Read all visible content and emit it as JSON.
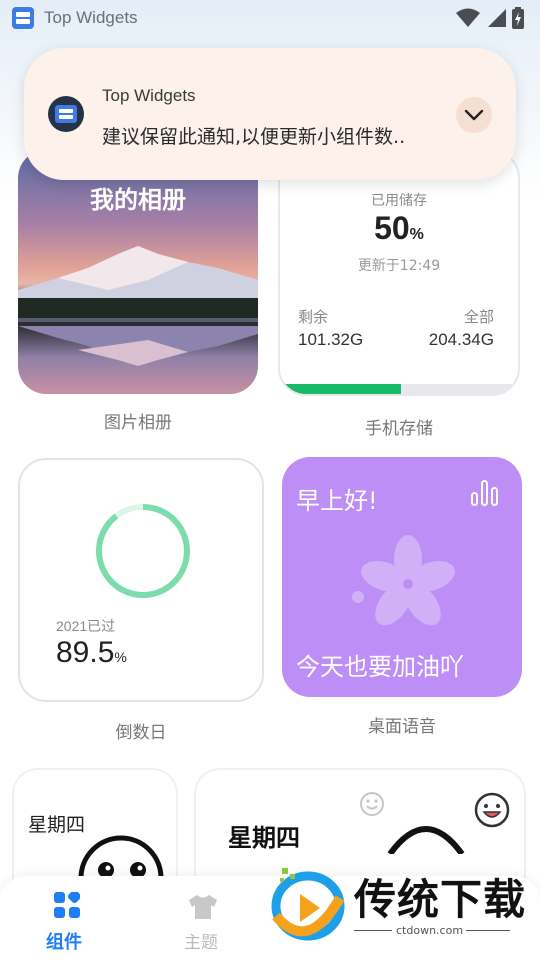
{
  "status_bar": {
    "app_title": "Top Widgets"
  },
  "notification": {
    "app_name": "Top Widgets",
    "message": "建议保留此通知,以便更新小组件数..",
    "expand_icon": "chevron-down-icon"
  },
  "widgets": {
    "album": {
      "title": "我的相册",
      "label": "图片相册"
    },
    "storage": {
      "used_label": "已用储存",
      "percent_value": "50",
      "percent_unit": "%",
      "percent_fraction": 0.5,
      "updated": "更新于12:49",
      "remaining_label": "剩余",
      "remaining_value": "101.32G",
      "total_label": "全部",
      "total_value": "204.34G",
      "label": "手机存储",
      "bar_color": "#19b96a"
    },
    "countdown": {
      "sub_label": "2021已过",
      "value": "89.5",
      "unit": "%",
      "ring_color": "#7ddcae",
      "label": "倒数日"
    },
    "voice": {
      "greeting": "早上好!",
      "message": "今天也要加油吖",
      "bg_color": "#bd8ef5",
      "icons": [
        "bars-icon",
        "flower-icon"
      ],
      "label": "桌面语音"
    },
    "weekday": {
      "day": "星期四",
      "day2": "星期四"
    }
  },
  "bottom_nav": {
    "tabs": [
      {
        "label": "组件",
        "icon": "widgets-icon",
        "active": true
      },
      {
        "label": "主题",
        "icon": "shirt-icon",
        "active": false
      }
    ],
    "accent": "#1f7ef4"
  },
  "watermark": {
    "brand": "传统下载",
    "url": "ctdown.com"
  }
}
